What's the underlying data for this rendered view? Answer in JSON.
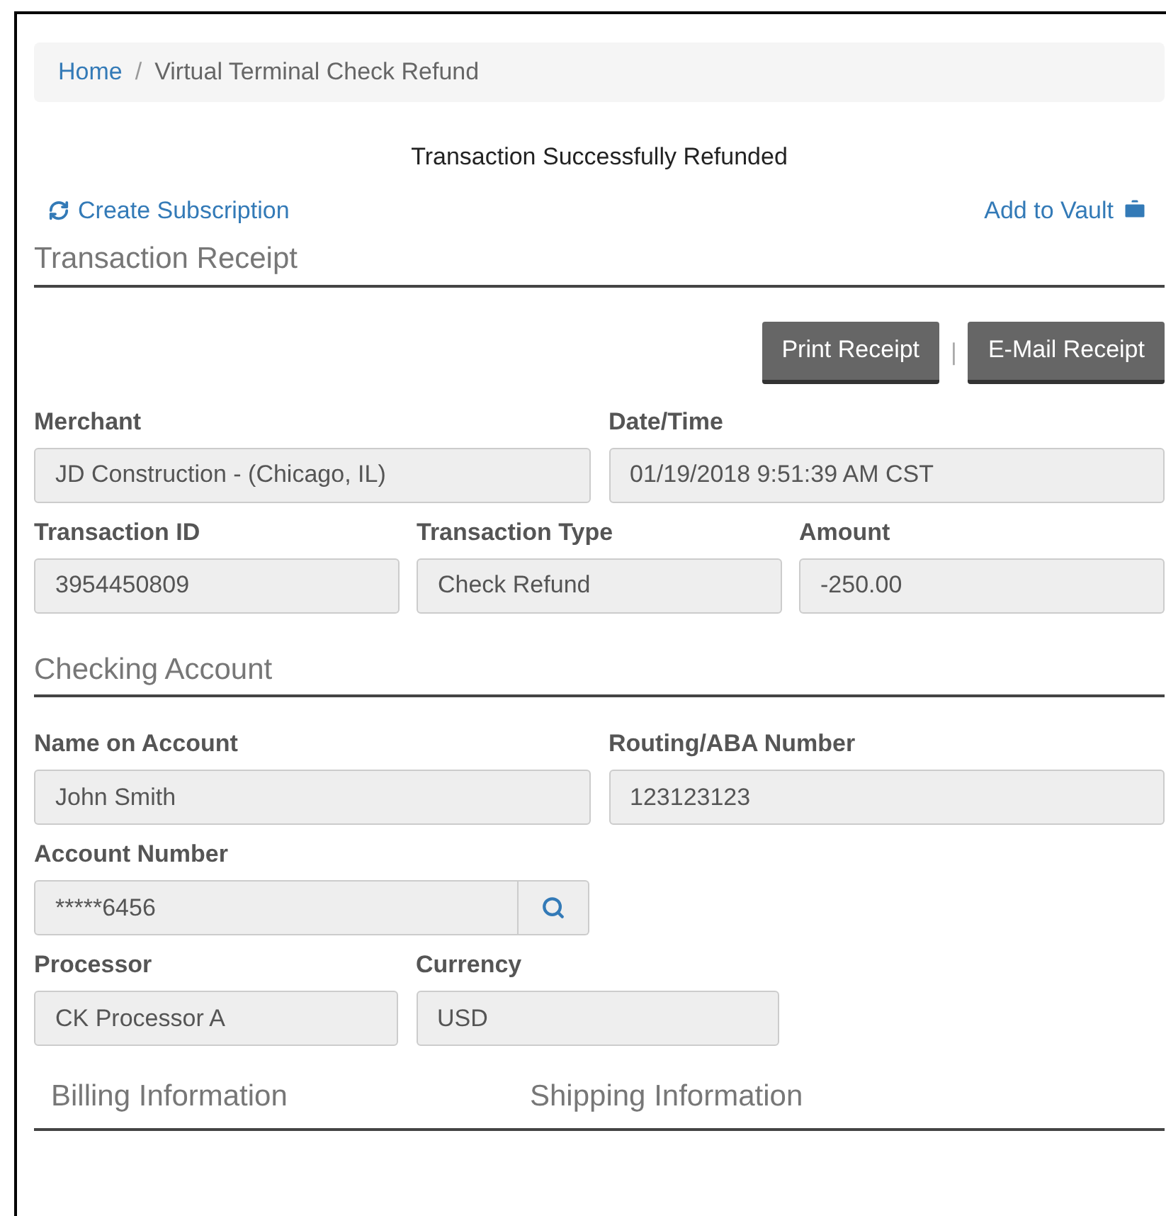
{
  "breadcrumb": {
    "separator": "/",
    "items": [
      {
        "label": "Home",
        "kind": "link"
      },
      {
        "label": "Virtual Terminal Check Refund",
        "kind": "current"
      }
    ]
  },
  "status_message": "Transaction Successfully Refunded",
  "actions": {
    "left": "Create Subscription",
    "right": "Add to Vault"
  },
  "receipt": {
    "title": "Transaction Receipt",
    "buttons": [
      "Print Receipt",
      "E-Mail Receipt"
    ],
    "separator": "|",
    "lines": [
      {
        "fields": [
          {
            "label": "Merchant",
            "value": "JD Construction - (Chicago, IL)"
          },
          {
            "label": "Date/Time",
            "value": "01/19/2018 9:51:39 AM CST"
          }
        ]
      },
      {
        "fields": [
          {
            "label": "Transaction ID",
            "value": "3954450809"
          },
          {
            "label": "Transaction Type",
            "value": "Check Refund"
          },
          {
            "label": "Amount",
            "value": "-250.00"
          }
        ]
      }
    ]
  },
  "checking": {
    "title": "Checking Account",
    "lines": [
      {
        "fields": [
          {
            "label": "Name on Account",
            "value": "John Smith"
          },
          {
            "label": "Routing/ABA Number",
            "value": "123123123"
          }
        ]
      },
      {
        "kind": "partial",
        "fields": [
          {
            "label": "Account Number",
            "value": "*****6456",
            "kind": "search"
          }
        ]
      },
      {
        "kind": "partial",
        "fields": [
          {
            "label": "Processor",
            "value": "CK Processor A"
          },
          {
            "label": "Currency",
            "value": "USD"
          }
        ]
      }
    ]
  },
  "tabs": [
    "Billing Information",
    "Shipping Information"
  ]
}
